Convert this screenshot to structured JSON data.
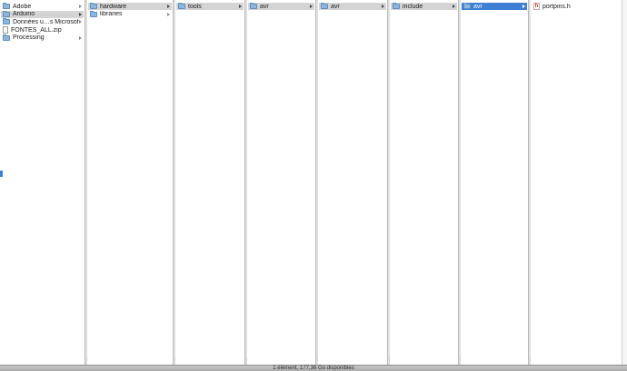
{
  "columns": [
    {
      "items": [
        {
          "label": "Adobe",
          "icon": "folder-icon",
          "has_children": true,
          "selected": false
        },
        {
          "label": "Arduino",
          "icon": "folder-icon",
          "has_children": true,
          "selected": "inactive"
        },
        {
          "label": "Données u…s Microsoft",
          "icon": "folder-icon",
          "has_children": true,
          "selected": false
        },
        {
          "label": "FONTES_ALL.zip",
          "icon": "document-icon",
          "has_children": false,
          "selected": false
        },
        {
          "label": "Processing",
          "icon": "folder-icon",
          "has_children": true,
          "selected": false
        }
      ]
    },
    {
      "items": [
        {
          "label": "hardware",
          "icon": "folder-icon",
          "has_children": true,
          "selected": "inactive"
        },
        {
          "label": "libraries",
          "icon": "folder-icon",
          "has_children": true,
          "selected": false
        }
      ]
    },
    {
      "items": [
        {
          "label": "tools",
          "icon": "folder-icon",
          "has_children": true,
          "selected": "inactive"
        }
      ]
    },
    {
      "items": [
        {
          "label": "avr",
          "icon": "folder-icon",
          "has_children": true,
          "selected": "inactive"
        }
      ]
    },
    {
      "items": [
        {
          "label": "avr",
          "icon": "folder-icon",
          "has_children": true,
          "selected": "inactive"
        }
      ]
    },
    {
      "items": [
        {
          "label": "include",
          "icon": "folder-icon",
          "has_children": true,
          "selected": "inactive"
        }
      ]
    },
    {
      "items": [
        {
          "label": "avr",
          "icon": "folder-icon",
          "has_children": true,
          "selected": "active"
        }
      ]
    },
    {
      "items": [
        {
          "label": "portpins.h",
          "icon": "header-file-icon",
          "has_children": false,
          "selected": false
        }
      ]
    }
  ],
  "status": {
    "text": "1 élément, 177,36 Go disponibles"
  },
  "colors": {
    "selection_active": "#3c7fd4",
    "selection_inactive": "#d4d4d4",
    "folder_fill": "#8cb6dc"
  }
}
